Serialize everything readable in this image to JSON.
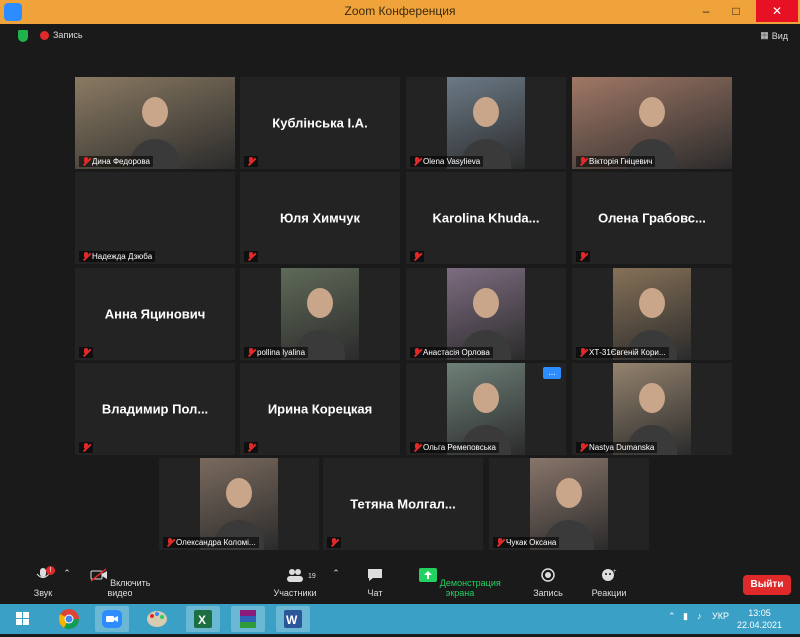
{
  "window": {
    "title": "Zoom Конференция",
    "minimize": "–",
    "maximize": "□",
    "close": "✕"
  },
  "recording": {
    "label": "Запись"
  },
  "view": {
    "label": "Вид"
  },
  "participants": [
    {
      "label": "Дина Федорова",
      "has_video": true,
      "active": true
    },
    {
      "big_name": "Кублінська І.А.",
      "label": "",
      "has_video": false
    },
    {
      "label": "Olena Vasylieva",
      "has_video": true
    },
    {
      "label": "Вікторія Гніцевич",
      "has_video": true
    },
    {
      "big_name": "",
      "label": "Надежда Дзюба",
      "has_video": false
    },
    {
      "big_name": "Юля Химчук",
      "label": "",
      "has_video": false
    },
    {
      "big_name": "Karolina Khuda...",
      "label": "",
      "has_video": false
    },
    {
      "big_name": "Олена Грабовс...",
      "label": "",
      "has_video": false
    },
    {
      "big_name": "Анна Яцинович",
      "label": "",
      "has_video": false
    },
    {
      "label": "pollina lyalina",
      "has_video": true
    },
    {
      "label": "Анастасія Орлова",
      "has_video": true
    },
    {
      "label": "ХТ-31Євгеній Кори...",
      "has_video": true
    },
    {
      "big_name": "Владимир Пол...",
      "label": "",
      "has_video": false
    },
    {
      "big_name": "Ирина Корецкая",
      "label": "",
      "has_video": false
    },
    {
      "label": "Ольга Ремеповська",
      "has_video": true,
      "more": "..."
    },
    {
      "label": "Nastya Dumanska",
      "has_video": true
    },
    {
      "label": "Олександра Коломі...",
      "has_video": true
    },
    {
      "big_name": "Тетяна Молгал...",
      "label": "",
      "has_video": false
    },
    {
      "label": "Чукак Оксана",
      "has_video": true
    }
  ],
  "toolbar": {
    "audio": "Звук",
    "audio_badge": "!",
    "video": "Включить видео",
    "participants": "Участники",
    "participants_count": "19",
    "chat": "Чат",
    "share": "Демонстрация экрана",
    "record": "Запись",
    "reactions": "Реакции",
    "leave": "Выйти"
  },
  "taskbar": {
    "language": "УКР",
    "time": "13:05",
    "date": "22.04.2021",
    "apps": [
      "windows-start",
      "chrome",
      "zoom",
      "paint",
      "excel",
      "winrar",
      "word"
    ]
  },
  "colors": {
    "accent": "#2d8cff",
    "active_border": "#c6ea53",
    "leave": "#e02a2a",
    "share_green": "#23d160",
    "titlebar": "#f0a33a",
    "taskbar": "#3aa0c6"
  }
}
